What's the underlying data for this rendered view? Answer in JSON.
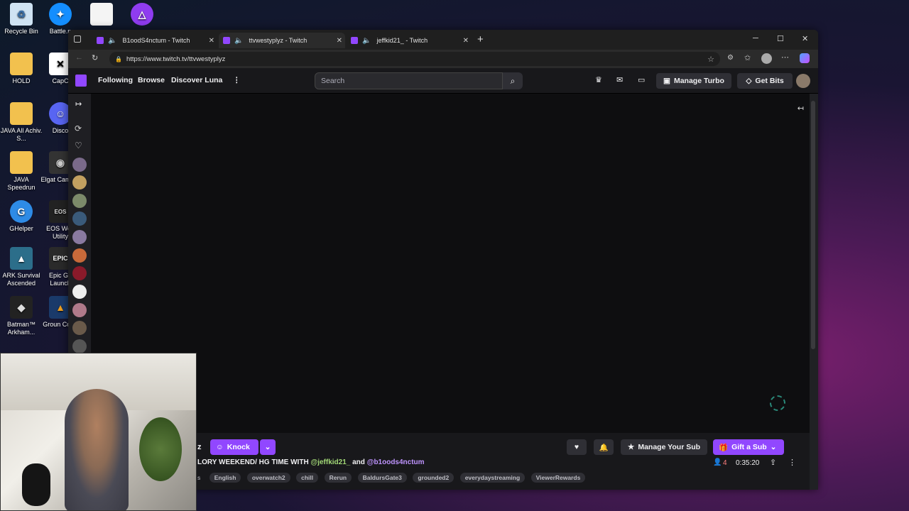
{
  "desktop": {
    "icons_col1": [
      {
        "label": "Recycle Bin",
        "icon": "recycle-bin-icon"
      },
      {
        "label": "HOLD",
        "icon": "folder-icon"
      },
      {
        "label": "JAVA All Achiv. S...",
        "icon": "folder-icon"
      },
      {
        "label": "JAVA Speedrun",
        "icon": "folder-icon"
      },
      {
        "label": "GHelper",
        "icon": "ghelper-icon"
      },
      {
        "label": "ARK Survival Ascended",
        "icon": "ark-icon"
      },
      {
        "label": "Batman™ Arkham...",
        "icon": "batman-icon"
      }
    ],
    "icons_col2": [
      {
        "label": "Battle.n",
        "icon": "battlenet-icon"
      },
      {
        "label": "CapC",
        "icon": "capcut-icon"
      },
      {
        "label": "Disco",
        "icon": "discord-icon"
      },
      {
        "label": "Elgat Camera",
        "icon": "elgato-icon"
      },
      {
        "label": "EOS Web Utility",
        "icon": "eos-icon"
      },
      {
        "label": "Epic Ga Launch",
        "icon": "epic-icon"
      },
      {
        "label": "Groun Contr",
        "icon": "ground-control-icon"
      }
    ]
  },
  "browser": {
    "tabs": [
      {
        "title": "B1oodS4nctum - Twitch"
      },
      {
        "title": "ttvwestyplyz - Twitch"
      },
      {
        "title": "jeffkid21_ - Twitch"
      }
    ],
    "new_tab": "+",
    "url": "https://www.twitch.tv/ttvwestyplyz"
  },
  "twitch": {
    "nav": {
      "following": "Following",
      "browse": "Browse",
      "discover": "Discover Luna",
      "more": "⋮"
    },
    "search_placeholder": "Search",
    "manage_turbo": "Manage Turbo",
    "get_bits": "Get Bits",
    "channel": {
      "name_fragment": "z",
      "knock": "Knock",
      "title_prefix": "LORY WEEKEND/ HG TIME WITH",
      "mention1": "@jeffkid21_",
      "and": "and",
      "mention2": "@b1oods4nctum",
      "tags_prefix": "s",
      "tags": [
        "English",
        "overwatch2",
        "chill",
        "Rerun",
        "BaldursGate3",
        "grounded2",
        "everydaystreaming",
        "ViewerRewards"
      ],
      "manage_sub": "Manage Your Sub",
      "gift_sub": "Gift a Sub",
      "viewers": "4",
      "uptime": "0:35:20"
    },
    "colors": {
      "purple": "#9147ff",
      "mention_green": "#a3d977",
      "mention_purple": "#bf94ff"
    }
  }
}
